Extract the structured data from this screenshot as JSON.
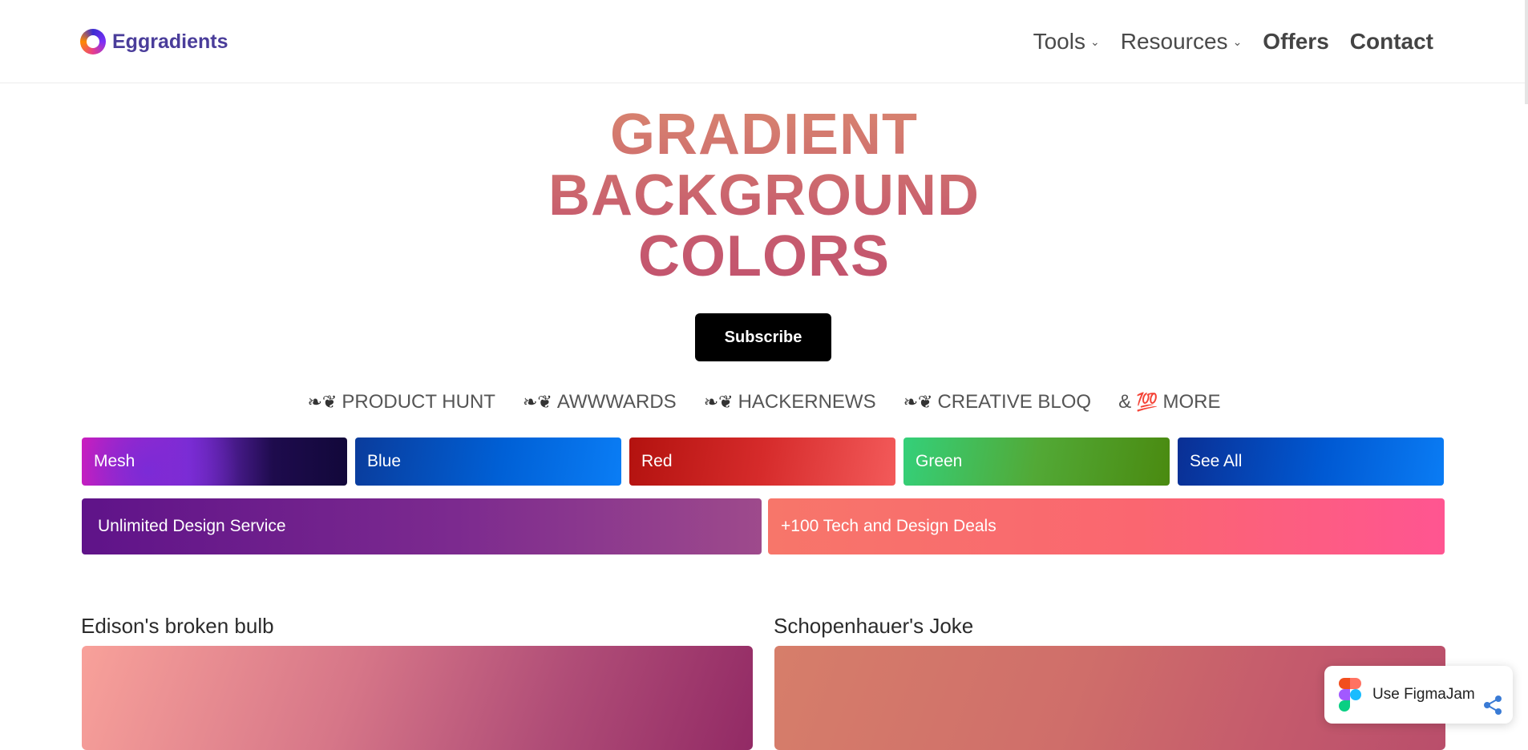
{
  "brand": {
    "name": "Eggradients"
  },
  "nav": {
    "tools": "Tools",
    "resources": "Resources",
    "offers": "Offers",
    "contact": "Contact"
  },
  "hero": {
    "line1": "GRADIENT",
    "line2": "BACKGROUND",
    "line3": "COLORS",
    "subscribe_label": "Subscribe"
  },
  "press": [
    {
      "icon": "laurel-icon",
      "label": "PRODUCT HUNT"
    },
    {
      "icon": "laurel-icon",
      "label": "AWWWARDS"
    },
    {
      "icon": "laurel-icon",
      "label": "HACKERNEWS"
    },
    {
      "icon": "laurel-icon",
      "label": "CREATIVE BLOQ"
    },
    {
      "icon": "hundred-emoji-icon",
      "prefix": "&",
      "label": "MORE"
    }
  ],
  "categories": {
    "mesh": "Mesh",
    "blue": "Blue",
    "red": "Red",
    "green": "Green",
    "see_all": "See All"
  },
  "banners": {
    "design": "Unlimited Design Service",
    "deals": "+100 Tech and Design Deals"
  },
  "cards": {
    "left_title": "Edison's broken bulb",
    "right_title": "Schopenhauer's Joke"
  },
  "figma_popup": {
    "label": "Use FigmaJam",
    "icon": "figma-icon",
    "share_icon": "share-icon"
  },
  "colors": {
    "brand": "#4a3d9a",
    "title_top": "#d8846f",
    "title_bottom": "#c2536e",
    "subscribe_bg": "#000000"
  }
}
